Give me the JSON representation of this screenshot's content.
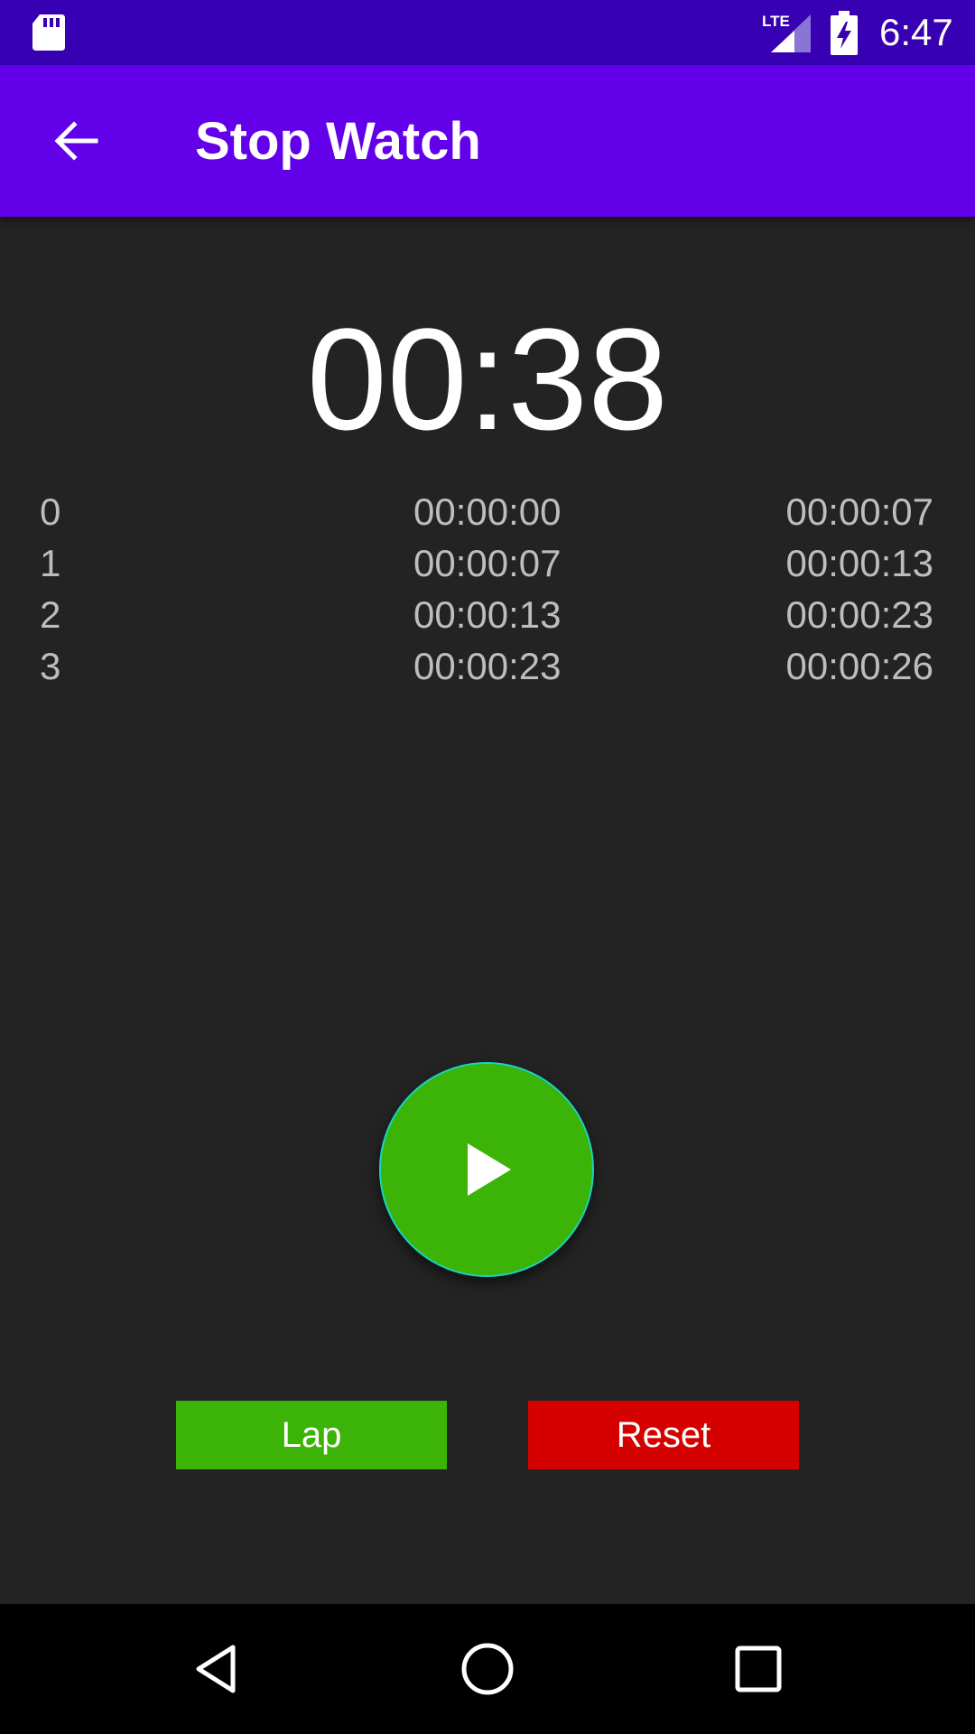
{
  "status_bar": {
    "time": "6:47",
    "icons": [
      "sd-card-icon",
      "lte-signal-icon",
      "battery-charging-icon"
    ]
  },
  "app_bar": {
    "title": "Stop Watch",
    "back_icon": "arrow-back-icon"
  },
  "timer": {
    "display": "00:38"
  },
  "laps": [
    {
      "index": "0",
      "start": "00:00:00",
      "end": "00:00:07"
    },
    {
      "index": "1",
      "start": "00:00:07",
      "end": "00:00:13"
    },
    {
      "index": "2",
      "start": "00:00:13",
      "end": "00:00:23"
    },
    {
      "index": "3",
      "start": "00:00:23",
      "end": "00:00:26"
    }
  ],
  "controls": {
    "play_icon": "play-icon",
    "lap_label": "Lap",
    "reset_label": "Reset"
  },
  "nav_bar": {
    "icons": [
      "nav-back-icon",
      "nav-home-icon",
      "nav-recents-icon"
    ]
  },
  "colors": {
    "status_bar": "#3700b3",
    "app_bar": "#6200ea",
    "background": "#232323",
    "play_button": "#3cb307",
    "play_button_border": "#18d3c6",
    "lap_button": "#3cb307",
    "reset_button": "#d50000",
    "lap_text": "#bdbdbd"
  }
}
